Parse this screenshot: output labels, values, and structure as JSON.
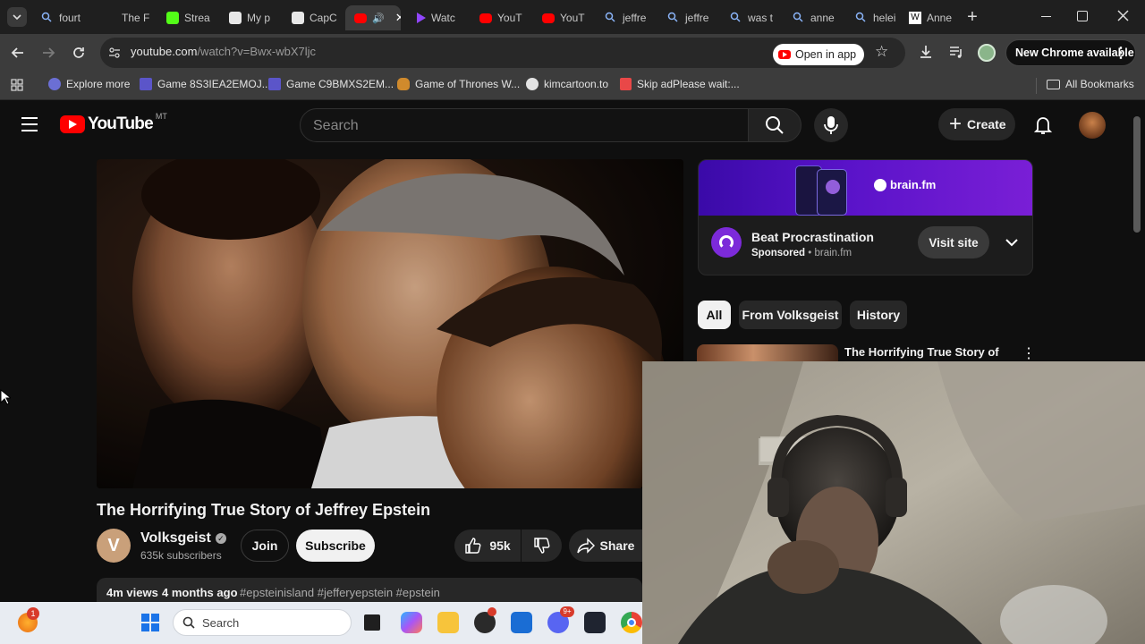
{
  "tabs": [
    {
      "label": "fourt",
      "icon": "search-icon"
    },
    {
      "label": "The F",
      "icon": "blank-icon"
    },
    {
      "label": "Strea",
      "icon": "kick-icon"
    },
    {
      "label": "My p",
      "icon": "capcut-icon"
    },
    {
      "label": "CapC",
      "icon": "capcut-icon"
    },
    {
      "label": "",
      "icon": "youtube-audio-icon"
    },
    {
      "label": "Watc",
      "icon": "play-icon"
    },
    {
      "label": "YouT",
      "icon": "youtube-icon"
    },
    {
      "label": "YouT",
      "icon": "youtube-icon"
    },
    {
      "label": "jeffre",
      "icon": "search-icon"
    },
    {
      "label": "jeffre",
      "icon": "search-icon"
    },
    {
      "label": "was t",
      "icon": "search-icon"
    },
    {
      "label": "anne",
      "icon": "search-icon"
    },
    {
      "label": "helei",
      "icon": "search-icon"
    },
    {
      "label": "Anne",
      "icon": "wikipedia-icon"
    }
  ],
  "address": {
    "url_host": "youtube.com",
    "url_path": "/watch?v=Bwx-wbX7ljc",
    "open_in_app": "Open in app",
    "new_chrome": "New Chrome available"
  },
  "bookmarks": {
    "items": [
      "Explore more",
      "Game 8S3IEA2EMOJ...",
      "Game C9BMXS2EM...",
      "Game of Thrones W...",
      "kimcartoon.to",
      "Skip adPlease wait:..."
    ],
    "all": "All Bookmarks"
  },
  "yt": {
    "logo_text": "YouTube",
    "region": "MT",
    "search_placeholder": "Search",
    "create": "Create"
  },
  "video": {
    "title": "The Horrifying True Story of Jeffrey Epstein",
    "channel": "Volksgeist",
    "channel_initial": "V",
    "subscribers": "635k subscribers",
    "join": "Join",
    "subscribe": "Subscribe",
    "likes": "95k",
    "share": "Share",
    "views": "4m views",
    "age": "4 months ago",
    "hashtags": "#epsteinisland #jefferyepstein #epstein"
  },
  "ad": {
    "brand_banner": "brain.fm",
    "title": "Beat Procrastination",
    "sponsored": "Sponsored",
    "domain": "brain.fm",
    "cta": "Visit site"
  },
  "chips": [
    "All",
    "From Volksgeist",
    "History"
  ],
  "next_video": {
    "title": "The Horrifying True Story of"
  },
  "taskbar": {
    "search": "Search",
    "notification_count": "1",
    "discord_badge": "9+"
  },
  "colors": {
    "yt_red": "#ff0000",
    "chrome_bar": "#3c3c3c",
    "page_bg": "#0f0f0f"
  }
}
